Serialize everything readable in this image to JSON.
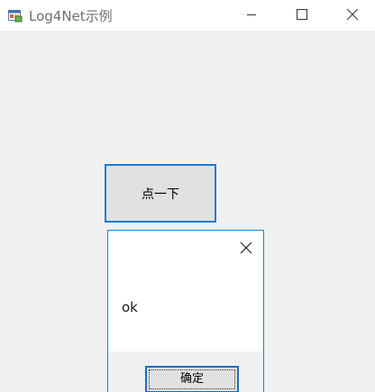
{
  "window": {
    "title": "Log4Net示例",
    "app_icon": "winforms-app-icon",
    "controls": {
      "minimize": "minimize-icon",
      "maximize": "maximize-icon",
      "close": "close-icon"
    }
  },
  "main": {
    "button_label": "点一下"
  },
  "message_box": {
    "text": "ok",
    "close_icon": "close-icon",
    "ok_label": "确定"
  },
  "colors": {
    "accent": "#1c7bd1",
    "background": "#f0f0f0",
    "button_face": "#e1e1e1"
  }
}
